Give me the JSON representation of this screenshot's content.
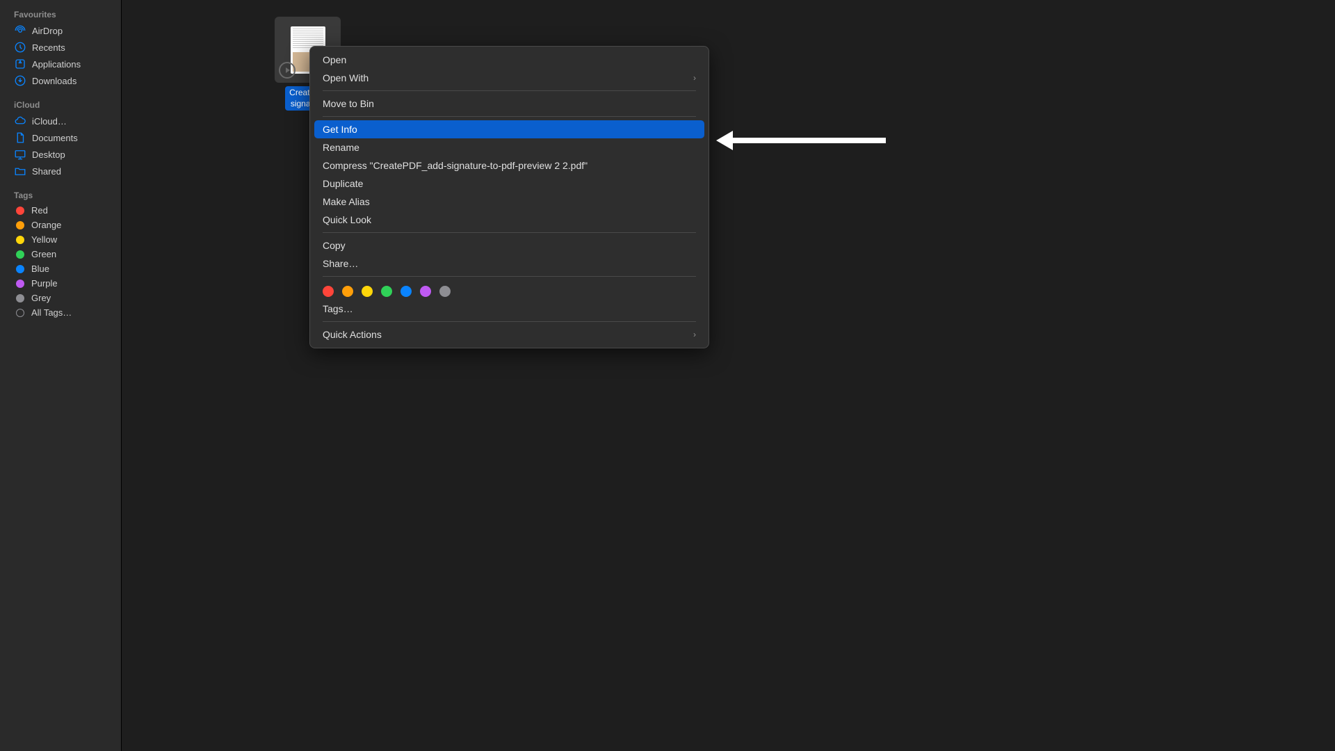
{
  "sidebar": {
    "sections": {
      "favourites": {
        "header": "Favourites",
        "items": [
          "AirDrop",
          "Recents",
          "Applications",
          "Downloads"
        ]
      },
      "icloud": {
        "header": "iCloud",
        "items": [
          "iCloud…",
          "Documents",
          "Desktop",
          "Shared"
        ]
      },
      "tags": {
        "header": "Tags",
        "items": [
          "Red",
          "Orange",
          "Yellow",
          "Green",
          "Blue",
          "Purple",
          "Grey",
          "All Tags…"
        ]
      }
    }
  },
  "file": {
    "label_line1": "CreatePD",
    "label_line2": "signature"
  },
  "context_menu": {
    "open": "Open",
    "open_with": "Open With",
    "move_to_bin": "Move to Bin",
    "get_info": "Get Info",
    "rename": "Rename",
    "compress": "Compress \"CreatePDF_add-signature-to-pdf-preview 2 2.pdf\"",
    "duplicate": "Duplicate",
    "make_alias": "Make Alias",
    "quick_look": "Quick Look",
    "copy": "Copy",
    "share": "Share…",
    "tags": "Tags…",
    "quick_actions": "Quick Actions"
  },
  "colors": {
    "accent": "#0a5fce",
    "tag_colors": [
      "#ff453a",
      "#ff9f0a",
      "#ffd60a",
      "#30d158",
      "#0a84ff",
      "#bf5af2",
      "#8e8e93"
    ]
  }
}
